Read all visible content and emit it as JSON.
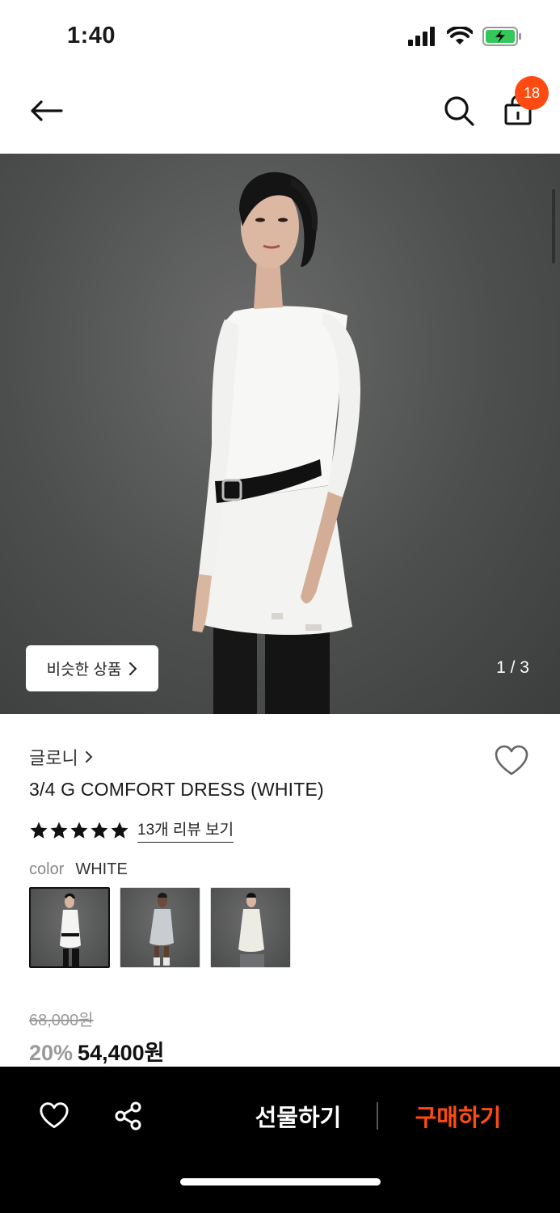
{
  "status_bar": {
    "time": "1:40",
    "battery_color": "#34c759"
  },
  "header": {
    "cart_count": "18",
    "accent_color": "#ff4b12"
  },
  "hero": {
    "similar_button_label": "비슷한 상품",
    "page_indicator": "1 / 3",
    "current_image": 1,
    "total_images": 3
  },
  "product": {
    "brand": "글로니",
    "name": "3/4 G COMFORT DRESS (WHITE)",
    "rating_stars": 5,
    "review_link": "13개 리뷰 보기",
    "color_label": "color",
    "color_value": "WHITE",
    "thumbnails": [
      "white-dress-thumb",
      "grey-dress-thumb",
      "ivory-dress-thumb"
    ],
    "selected_thumbnail": 0
  },
  "price": {
    "original": "68,000원",
    "discount": "20%",
    "sale": "54,400원"
  },
  "bottom_bar": {
    "gift_label": "선물하기",
    "buy_label": "구매하기"
  },
  "icons": {
    "back": "arrow-left-icon",
    "search": "search-icon",
    "cart": "shopping-bag-icon",
    "wishlist": "heart-icon",
    "share": "share-icon",
    "chevron": "chevron-right-icon",
    "star": "star-icon"
  }
}
